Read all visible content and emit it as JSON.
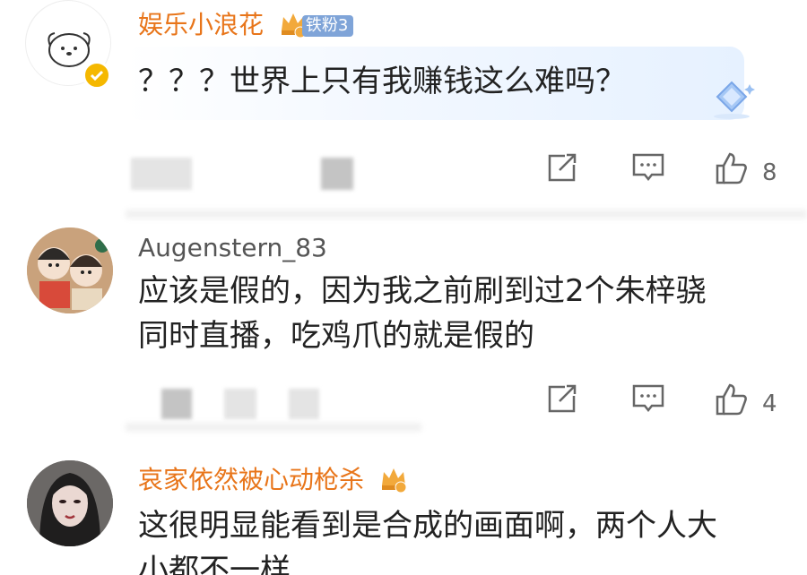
{
  "comments": [
    {
      "username": "娱乐小浪花",
      "fan_badge": "铁粉3",
      "content_lines": [
        "？？？世界上只有我赚钱这么难吗？"
      ],
      "likes": "8"
    },
    {
      "username": "Augenstern_83",
      "content_lines": [
        "应该是假的，因为我之前刷到过2个朱梓骁",
        "同时直播，吃鸡爪的就是假的"
      ],
      "likes": "4"
    },
    {
      "username": "哀家依然被心动枪杀",
      "content_lines": [
        "这很明显能看到是合成的画面啊，两个人大",
        "小都不一样"
      ]
    }
  ],
  "icons": {
    "share": "share-icon",
    "comment": "comment-icon",
    "like": "like-icon",
    "vip_badge": "crown-icon",
    "verified": "verified-check-icon",
    "sticker": "diamond-sticker-icon"
  },
  "colors": {
    "vip_name": "#e8751a",
    "normal_name": "#555555",
    "fan_badge": "#7fa4d8",
    "verified": "#f5b800"
  }
}
